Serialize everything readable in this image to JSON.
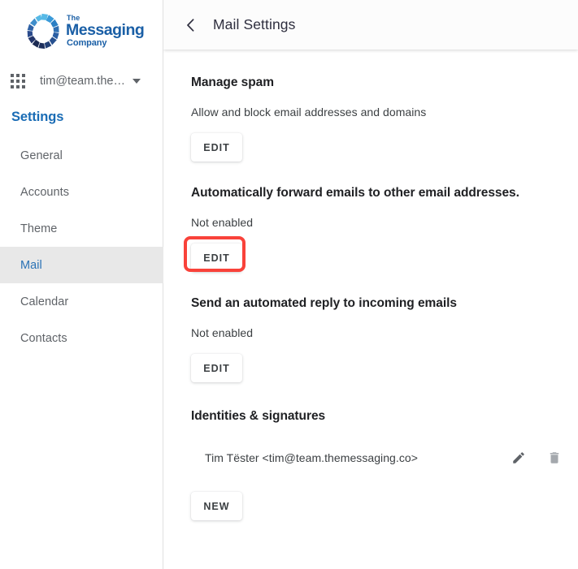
{
  "brand": {
    "line1": "The",
    "line2": "Messaging",
    "line3": "Company",
    "logo_icon": "messaging-ring-logo",
    "color": "#1a5fa6"
  },
  "sidebar": {
    "apps_icon": "apps-grid-icon",
    "account_email": "tim@team.the…",
    "account_caret_icon": "chevron-down-icon",
    "settings_heading": "Settings",
    "items": [
      {
        "label": "General",
        "active": false
      },
      {
        "label": "Accounts",
        "active": false
      },
      {
        "label": "Theme",
        "active": false
      },
      {
        "label": "Mail",
        "active": true
      },
      {
        "label": "Calendar",
        "active": false
      },
      {
        "label": "Contacts",
        "active": false
      }
    ],
    "active_color": "#2a72b5",
    "active_bg": "#e8e8e8"
  },
  "header": {
    "back_icon": "chevron-left-icon",
    "back_glyph": "‹",
    "title": "Mail Settings"
  },
  "sections": [
    {
      "title": "Manage spam",
      "description": "Allow and block email addresses and domains",
      "button_label": "EDIT",
      "highlighted": false
    },
    {
      "title": "Automatically forward emails to other email addresses.",
      "description": "Not enabled",
      "button_label": "EDIT",
      "highlighted": true
    },
    {
      "title": "Send an automated reply to incoming emails",
      "description": "Not enabled",
      "button_label": "EDIT",
      "highlighted": false
    }
  ],
  "identities": {
    "title": "Identities & signatures",
    "rows": [
      {
        "label": "Tim Tëster <tim@team.themessaging.co>",
        "edit_icon": "pencil-icon",
        "delete_icon": "trash-icon"
      }
    ],
    "new_button_label": "NEW"
  },
  "annotation": {
    "target": "forward-emails-edit-button",
    "color": "#f9423a"
  }
}
